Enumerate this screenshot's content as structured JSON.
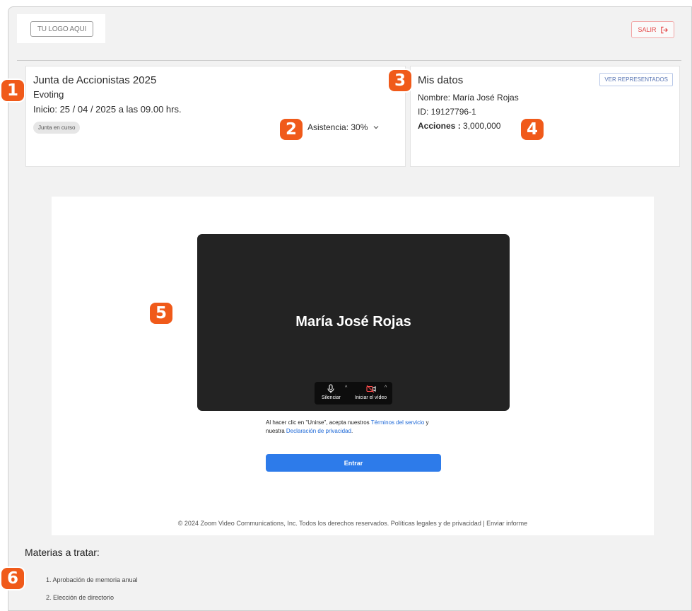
{
  "header": {
    "logo_text": "TU LOGO AQUI",
    "logout_label": "SALIR"
  },
  "junta": {
    "title": "Junta de Accionistas 2025",
    "type": "Evoting",
    "inicio": "Inicio: 25 / 04 / 2025 a las 09.00 hrs.",
    "status_badge": "Junta en curso",
    "asistencia": "Asistencia: 30%"
  },
  "mis_datos": {
    "title": "Mis datos",
    "ver_representados": "VER REPRESENTADOS",
    "nombre": "Nombre: María José Rojas",
    "id": "ID: 19127796-1",
    "acciones_label": "Acciones :",
    "acciones_value": "3,000,000"
  },
  "zoom": {
    "participant_name": "María José Rojas",
    "mute_label": "Silenciar",
    "video_label": "Iniciar el vídeo",
    "terms_prefix": "Al hacer clic en \"Unirse\", acepta nuestros ",
    "terms_link": "Términos del servicio",
    "terms_middle": " y nuestra ",
    "privacy_link": "Declaración de privacidad",
    "terms_suffix": ".",
    "join_button": "Entrar",
    "footer": "© 2024 Zoom Video Communications, Inc. Todos los derechos reservados. Políticas legales y de privacidad  |  Enviar informe"
  },
  "materias": {
    "title": "Materias a tratar:",
    "items": [
      "1. Aprobación de memoria anual",
      "2. Elección de directorio"
    ]
  },
  "markers": [
    "1",
    "2",
    "3",
    "4",
    "5",
    "6"
  ],
  "colors": {
    "marker": "#f05a1a",
    "logout": "#e44a4a",
    "join_button": "#2d7bea",
    "video_bg": "#232323",
    "link": "#1a66d6"
  }
}
